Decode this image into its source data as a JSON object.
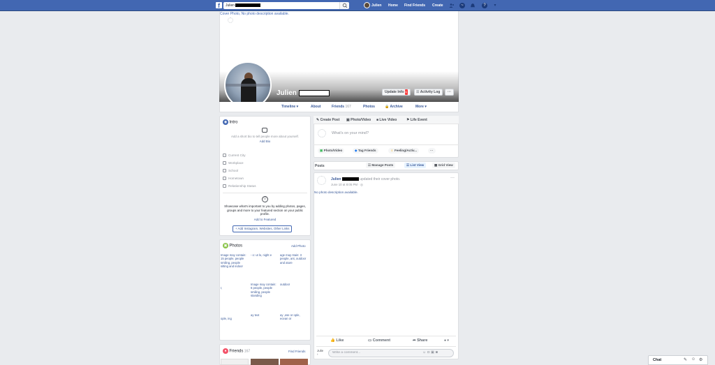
{
  "topbar": {
    "search_value": "Julien",
    "user_name": "Julien",
    "home": "Home",
    "find_friends": "Find Friends",
    "create": "Create"
  },
  "cover": {
    "alt_text": "Cover Photo, No photo description available.",
    "profile_name": "Julien",
    "update_info": "Update Info",
    "update_info_count": "1",
    "activity_log": "Activity Log",
    "more_dots": "···"
  },
  "tabs": {
    "timeline": "Timeline ▾",
    "about": "About",
    "friends": "Friends",
    "friends_count": "167",
    "photos": "Photos",
    "archive": "Archive",
    "more": "More ▾"
  },
  "intro": {
    "title": "Intro",
    "bio_prompt": "Add a short bio to tell people more about yourself.",
    "add_bio": "Add Bio",
    "rows": [
      "Current City",
      "Workplace",
      "School",
      "Hometown",
      "Relationship Status"
    ],
    "featured_text": "Showcase what's important to you by adding photos, pages, groups and more to your featured section on your public profile.",
    "add_featured": "Add to Featured",
    "add_links": "+ Add Instagram, Websites, Other Links"
  },
  "photos": {
    "title": "Photos",
    "add_photo": "Add Photo",
    "cells": [
      "Image may contain: 15 people, people smiling, people sitting and indoor",
      "- o: ut lo, night e",
      "age may ntain: 3 people, ant, outdoor and ature",
      "r,",
      "Image may contain: 6 people, people smiling, people standing",
      "outdoor",
      "ople, ing",
      "ay text",
      "ay ,ose or ople, ecean or"
    ]
  },
  "friends_card": {
    "title": "Friends",
    "count": "167",
    "find_friends": "Find Friends"
  },
  "composer": {
    "create_post": "Create Post",
    "photo_video": "Photo/Video",
    "live_video": "Live Video",
    "life_event": "Life Event",
    "placeholder": "What's on your mind?",
    "pill_photo": "Photo/Video",
    "pill_tag": "Tag Friends",
    "pill_feeling": "Feeling/Activ...",
    "pill_more": "···"
  },
  "posts_bar": {
    "label": "Posts",
    "manage": "Manage Posts",
    "list_view": "List View",
    "grid_view": "Grid View"
  },
  "post": {
    "author": "Julien",
    "action": "updated their cover photo.",
    "time": "June 10 at 8:05 PM · ",
    "menu": "···",
    "photo_alt": "No photo description available.",
    "like": "Like",
    "comment": "Comment",
    "share": "Share",
    "comment_author": "Julie",
    "comment_placeholder": "Write a comment..."
  },
  "chat": {
    "label": "Chat"
  },
  "colors": {
    "brand": "#4267b2",
    "link": "#385898",
    "background": "#e9ebee"
  }
}
